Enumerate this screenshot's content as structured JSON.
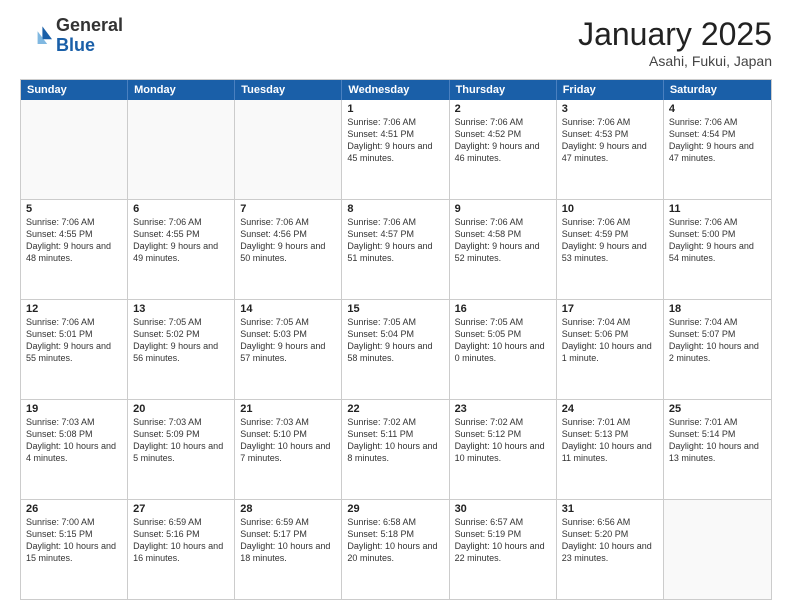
{
  "logo": {
    "general": "General",
    "blue": "Blue"
  },
  "header": {
    "month_year": "January 2025",
    "location": "Asahi, Fukui, Japan"
  },
  "days_of_week": [
    "Sunday",
    "Monday",
    "Tuesday",
    "Wednesday",
    "Thursday",
    "Friday",
    "Saturday"
  ],
  "weeks": [
    [
      {
        "day": "",
        "info": ""
      },
      {
        "day": "",
        "info": ""
      },
      {
        "day": "",
        "info": ""
      },
      {
        "day": "1",
        "info": "Sunrise: 7:06 AM\nSunset: 4:51 PM\nDaylight: 9 hours and 45 minutes."
      },
      {
        "day": "2",
        "info": "Sunrise: 7:06 AM\nSunset: 4:52 PM\nDaylight: 9 hours and 46 minutes."
      },
      {
        "day": "3",
        "info": "Sunrise: 7:06 AM\nSunset: 4:53 PM\nDaylight: 9 hours and 47 minutes."
      },
      {
        "day": "4",
        "info": "Sunrise: 7:06 AM\nSunset: 4:54 PM\nDaylight: 9 hours and 47 minutes."
      }
    ],
    [
      {
        "day": "5",
        "info": "Sunrise: 7:06 AM\nSunset: 4:55 PM\nDaylight: 9 hours and 48 minutes."
      },
      {
        "day": "6",
        "info": "Sunrise: 7:06 AM\nSunset: 4:55 PM\nDaylight: 9 hours and 49 minutes."
      },
      {
        "day": "7",
        "info": "Sunrise: 7:06 AM\nSunset: 4:56 PM\nDaylight: 9 hours and 50 minutes."
      },
      {
        "day": "8",
        "info": "Sunrise: 7:06 AM\nSunset: 4:57 PM\nDaylight: 9 hours and 51 minutes."
      },
      {
        "day": "9",
        "info": "Sunrise: 7:06 AM\nSunset: 4:58 PM\nDaylight: 9 hours and 52 minutes."
      },
      {
        "day": "10",
        "info": "Sunrise: 7:06 AM\nSunset: 4:59 PM\nDaylight: 9 hours and 53 minutes."
      },
      {
        "day": "11",
        "info": "Sunrise: 7:06 AM\nSunset: 5:00 PM\nDaylight: 9 hours and 54 minutes."
      }
    ],
    [
      {
        "day": "12",
        "info": "Sunrise: 7:06 AM\nSunset: 5:01 PM\nDaylight: 9 hours and 55 minutes."
      },
      {
        "day": "13",
        "info": "Sunrise: 7:05 AM\nSunset: 5:02 PM\nDaylight: 9 hours and 56 minutes."
      },
      {
        "day": "14",
        "info": "Sunrise: 7:05 AM\nSunset: 5:03 PM\nDaylight: 9 hours and 57 minutes."
      },
      {
        "day": "15",
        "info": "Sunrise: 7:05 AM\nSunset: 5:04 PM\nDaylight: 9 hours and 58 minutes."
      },
      {
        "day": "16",
        "info": "Sunrise: 7:05 AM\nSunset: 5:05 PM\nDaylight: 10 hours and 0 minutes."
      },
      {
        "day": "17",
        "info": "Sunrise: 7:04 AM\nSunset: 5:06 PM\nDaylight: 10 hours and 1 minute."
      },
      {
        "day": "18",
        "info": "Sunrise: 7:04 AM\nSunset: 5:07 PM\nDaylight: 10 hours and 2 minutes."
      }
    ],
    [
      {
        "day": "19",
        "info": "Sunrise: 7:03 AM\nSunset: 5:08 PM\nDaylight: 10 hours and 4 minutes."
      },
      {
        "day": "20",
        "info": "Sunrise: 7:03 AM\nSunset: 5:09 PM\nDaylight: 10 hours and 5 minutes."
      },
      {
        "day": "21",
        "info": "Sunrise: 7:03 AM\nSunset: 5:10 PM\nDaylight: 10 hours and 7 minutes."
      },
      {
        "day": "22",
        "info": "Sunrise: 7:02 AM\nSunset: 5:11 PM\nDaylight: 10 hours and 8 minutes."
      },
      {
        "day": "23",
        "info": "Sunrise: 7:02 AM\nSunset: 5:12 PM\nDaylight: 10 hours and 10 minutes."
      },
      {
        "day": "24",
        "info": "Sunrise: 7:01 AM\nSunset: 5:13 PM\nDaylight: 10 hours and 11 minutes."
      },
      {
        "day": "25",
        "info": "Sunrise: 7:01 AM\nSunset: 5:14 PM\nDaylight: 10 hours and 13 minutes."
      }
    ],
    [
      {
        "day": "26",
        "info": "Sunrise: 7:00 AM\nSunset: 5:15 PM\nDaylight: 10 hours and 15 minutes."
      },
      {
        "day": "27",
        "info": "Sunrise: 6:59 AM\nSunset: 5:16 PM\nDaylight: 10 hours and 16 minutes."
      },
      {
        "day": "28",
        "info": "Sunrise: 6:59 AM\nSunset: 5:17 PM\nDaylight: 10 hours and 18 minutes."
      },
      {
        "day": "29",
        "info": "Sunrise: 6:58 AM\nSunset: 5:18 PM\nDaylight: 10 hours and 20 minutes."
      },
      {
        "day": "30",
        "info": "Sunrise: 6:57 AM\nSunset: 5:19 PM\nDaylight: 10 hours and 22 minutes."
      },
      {
        "day": "31",
        "info": "Sunrise: 6:56 AM\nSunset: 5:20 PM\nDaylight: 10 hours and 23 minutes."
      },
      {
        "day": "",
        "info": ""
      }
    ]
  ]
}
